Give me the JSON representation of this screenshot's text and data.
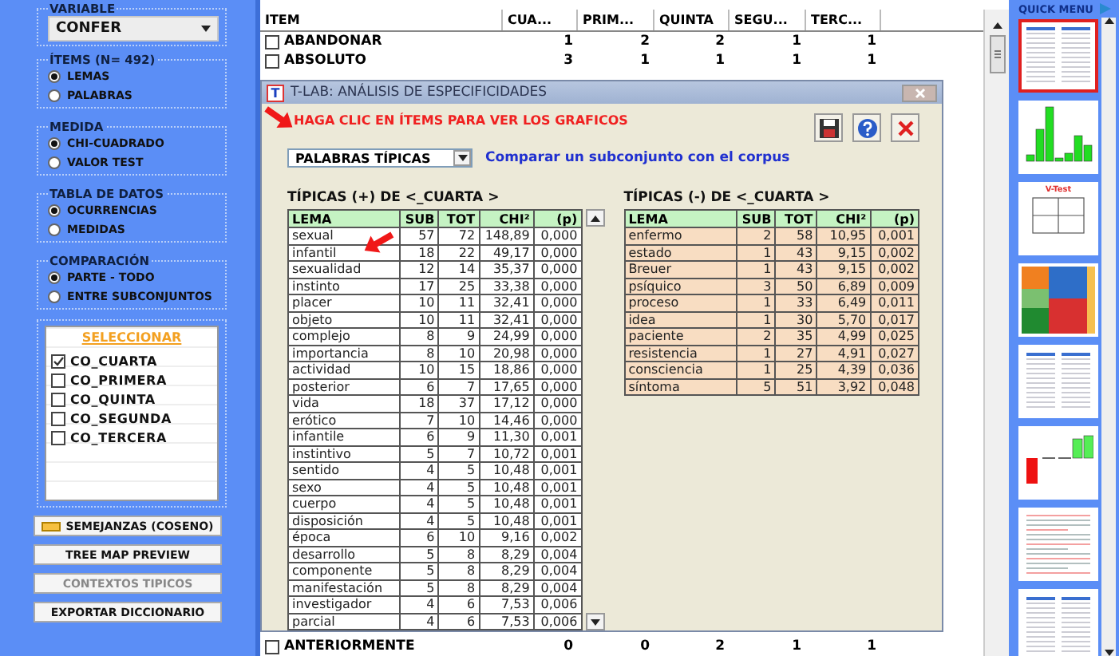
{
  "left_panel": {
    "variable": {
      "label": "VARIABLE",
      "value": "CONFER"
    },
    "groups": [
      {
        "label": "ÍTEMS (N= 492)",
        "options": [
          {
            "label": "LEMAS",
            "selected": true
          },
          {
            "label": "PALABRAS",
            "selected": false
          }
        ]
      },
      {
        "label": "MEDIDA",
        "options": [
          {
            "label": "CHI-CUADRADO",
            "selected": true
          },
          {
            "label": "VALOR TEST",
            "selected": false
          }
        ]
      },
      {
        "label": "TABLA DE DATOS",
        "options": [
          {
            "label": "OCURRENCIAS",
            "selected": true
          },
          {
            "label": "MEDIDAS",
            "selected": false
          }
        ]
      },
      {
        "label": "COMPARACIÓN",
        "options": [
          {
            "label": "PARTE - TODO",
            "selected": true
          },
          {
            "label": "ENTRE SUBCONJUNTOS",
            "selected": false
          }
        ]
      }
    ],
    "selection": {
      "link": "SELECCIONAR",
      "items": [
        {
          "label": "CO_CUARTA",
          "checked": true
        },
        {
          "label": "CO_PRIMERA",
          "checked": false
        },
        {
          "label": "CO_QUINTA",
          "checked": false
        },
        {
          "label": "CO_SEGUNDA",
          "checked": false
        },
        {
          "label": "CO_TERCERA",
          "checked": false
        }
      ]
    },
    "buttons": [
      {
        "label": "SEMEJANZAS (COSENO)",
        "kind": "icon",
        "disabled": false
      },
      {
        "label": "TREE MAP PREVIEW",
        "kind": "plain",
        "disabled": false
      },
      {
        "label": "CONTEXTOS TIPICOS",
        "kind": "plain",
        "disabled": true
      },
      {
        "label": "EXPORTAR DICCIONARIO",
        "kind": "plain",
        "disabled": false
      }
    ]
  },
  "main_table": {
    "columns": [
      "ITEM",
      "CUA...",
      "PRIM...",
      "QUINTA",
      "SEGU...",
      "TERC..."
    ],
    "rows_above_dialog": [
      {
        "item": "ABANDONAR",
        "checked": false,
        "values": [
          "1",
          "2",
          "2",
          "1",
          "1"
        ]
      },
      {
        "item": "ABSOLUTO",
        "checked": false,
        "values": [
          "3",
          "1",
          "1",
          "1",
          "1"
        ]
      }
    ],
    "rows_below_dialog": [
      {
        "item": "ANTERIORMENTE",
        "checked": false,
        "values": [
          "0",
          "0",
          "2",
          "1",
          "1"
        ]
      }
    ]
  },
  "dialog": {
    "icon_letter": "T",
    "title": "T-LAB: ANÁLISIS DE ESPECIFICIDADES",
    "instruction": "HAGA CLIC EN ÍTEMS PARA VER LOS GRAFICOS",
    "select": "PALABRAS TÍPICAS",
    "link": "Comparar un subconjunto con el corpus",
    "positive": {
      "title": "TÍPICAS (+) DE <_CUARTA >",
      "columns": [
        "LEMA",
        "SUB",
        "TOT",
        "CHI²",
        "(p)"
      ],
      "rows": [
        [
          "sexual",
          "57",
          "72",
          "148,89",
          "0,000"
        ],
        [
          "infantil",
          "18",
          "22",
          "49,17",
          "0,000"
        ],
        [
          "sexualidad",
          "12",
          "14",
          "35,37",
          "0,000"
        ],
        [
          "instinto",
          "17",
          "25",
          "33,38",
          "0,000"
        ],
        [
          "placer",
          "10",
          "11",
          "32,41",
          "0,000"
        ],
        [
          "objeto",
          "10",
          "11",
          "32,41",
          "0,000"
        ],
        [
          "complejo",
          "8",
          "9",
          "24,99",
          "0,000"
        ],
        [
          "importancia",
          "8",
          "10",
          "20,98",
          "0,000"
        ],
        [
          "actividad",
          "10",
          "15",
          "18,86",
          "0,000"
        ],
        [
          "posterior",
          "6",
          "7",
          "17,65",
          "0,000"
        ],
        [
          "vida",
          "18",
          "37",
          "17,12",
          "0,000"
        ],
        [
          "erótico",
          "7",
          "10",
          "14,46",
          "0,000"
        ],
        [
          "infantile",
          "6",
          "9",
          "11,30",
          "0,001"
        ],
        [
          "instintivo",
          "5",
          "7",
          "10,72",
          "0,001"
        ],
        [
          "sentido",
          "4",
          "5",
          "10,48",
          "0,001"
        ],
        [
          "sexo",
          "4",
          "5",
          "10,48",
          "0,001"
        ],
        [
          "cuerpo",
          "4",
          "5",
          "10,48",
          "0,001"
        ],
        [
          "disposición",
          "4",
          "5",
          "10,48",
          "0,001"
        ],
        [
          "época",
          "6",
          "10",
          "9,16",
          "0,002"
        ],
        [
          "desarrollo",
          "5",
          "8",
          "8,29",
          "0,004"
        ],
        [
          "componente",
          "5",
          "8",
          "8,29",
          "0,004"
        ],
        [
          "manifestación",
          "5",
          "8",
          "8,29",
          "0,004"
        ],
        [
          "investigador",
          "4",
          "6",
          "7,53",
          "0,006"
        ],
        [
          "parcial",
          "4",
          "6",
          "7,53",
          "0,006"
        ]
      ]
    },
    "negative": {
      "title": "TÍPICAS (-) DE <_CUARTA >",
      "columns": [
        "LEMA",
        "SUB",
        "TOT",
        "CHI²",
        "(p)"
      ],
      "rows": [
        [
          "enfermo",
          "2",
          "58",
          "10,95",
          "0,001"
        ],
        [
          "estado",
          "1",
          "43",
          "9,15",
          "0,002"
        ],
        [
          "Breuer",
          "1",
          "43",
          "9,15",
          "0,002"
        ],
        [
          "psíquico",
          "3",
          "50",
          "6,89",
          "0,009"
        ],
        [
          "proceso",
          "1",
          "33",
          "6,49",
          "0,011"
        ],
        [
          "idea",
          "1",
          "30",
          "5,70",
          "0,017"
        ],
        [
          "paciente",
          "2",
          "35",
          "4,99",
          "0,025"
        ],
        [
          "resistencia",
          "1",
          "27",
          "4,91",
          "0,027"
        ],
        [
          "consciencia",
          "1",
          "25",
          "4,39",
          "0,036"
        ],
        [
          "síntoma",
          "5",
          "51",
          "3,92",
          "0,048"
        ]
      ]
    }
  },
  "quick_menu": {
    "title": "QUICK MENU",
    "thumbnails": [
      {
        "kind": "table",
        "selected": true
      },
      {
        "kind": "bars",
        "selected": false
      },
      {
        "kind": "vtest",
        "label": "V-Test",
        "selected": false
      },
      {
        "kind": "treemap",
        "selected": false
      },
      {
        "kind": "table",
        "selected": false
      },
      {
        "kind": "signed_bars",
        "selected": false
      },
      {
        "kind": "text",
        "selected": false
      },
      {
        "kind": "table",
        "selected": false
      }
    ]
  }
}
